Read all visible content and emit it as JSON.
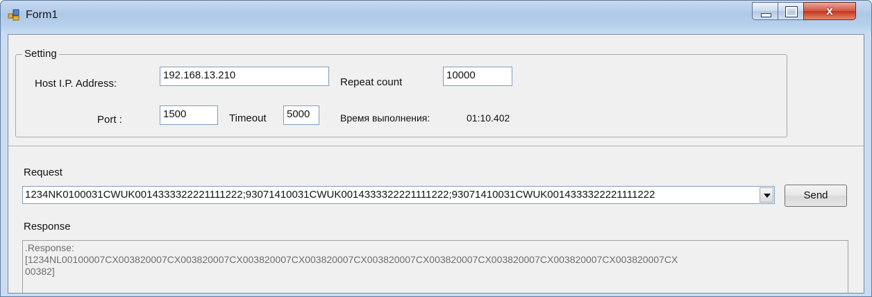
{
  "window": {
    "title": "Form1",
    "close_glyph": "x"
  },
  "icons": {
    "app": "form-icon",
    "minimize": "minimize-icon",
    "maximize": "maximize-icon",
    "close": "close-icon",
    "dropdown": "chevron-down-icon"
  },
  "setting": {
    "legend": "Setting",
    "host_label": "Host I.P. Address:",
    "host_value": "192.168.13.210",
    "port_label": "Port :",
    "port_value": "1500",
    "timeout_label": "Timeout",
    "timeout_value": "5000",
    "repeat_label": "Repeat count",
    "repeat_value": "10000",
    "exec_time_label": "Время выполнения:",
    "exec_time_value": "01:10.402"
  },
  "request": {
    "label": "Request",
    "value": "1234NK0100031CWUK0014333322221111222;93071410031CWUK0014333322221111222;93071410031CWUK0014333322221111222",
    "send_label": "Send"
  },
  "response": {
    "label": "Response",
    "lines": [
      ".Response:",
      "[1234NL00100007CX003820007CX003820007CX003820007CX003820007CX003820007CX003820007CX003820007CX003820007CX003820007CX",
      "00382]"
    ]
  },
  "colors": {
    "title_bar": "#b9d1ea",
    "client_bg": "#f0f0f0",
    "close_button": "#c9452f",
    "response_text": "#6d6d6d"
  }
}
